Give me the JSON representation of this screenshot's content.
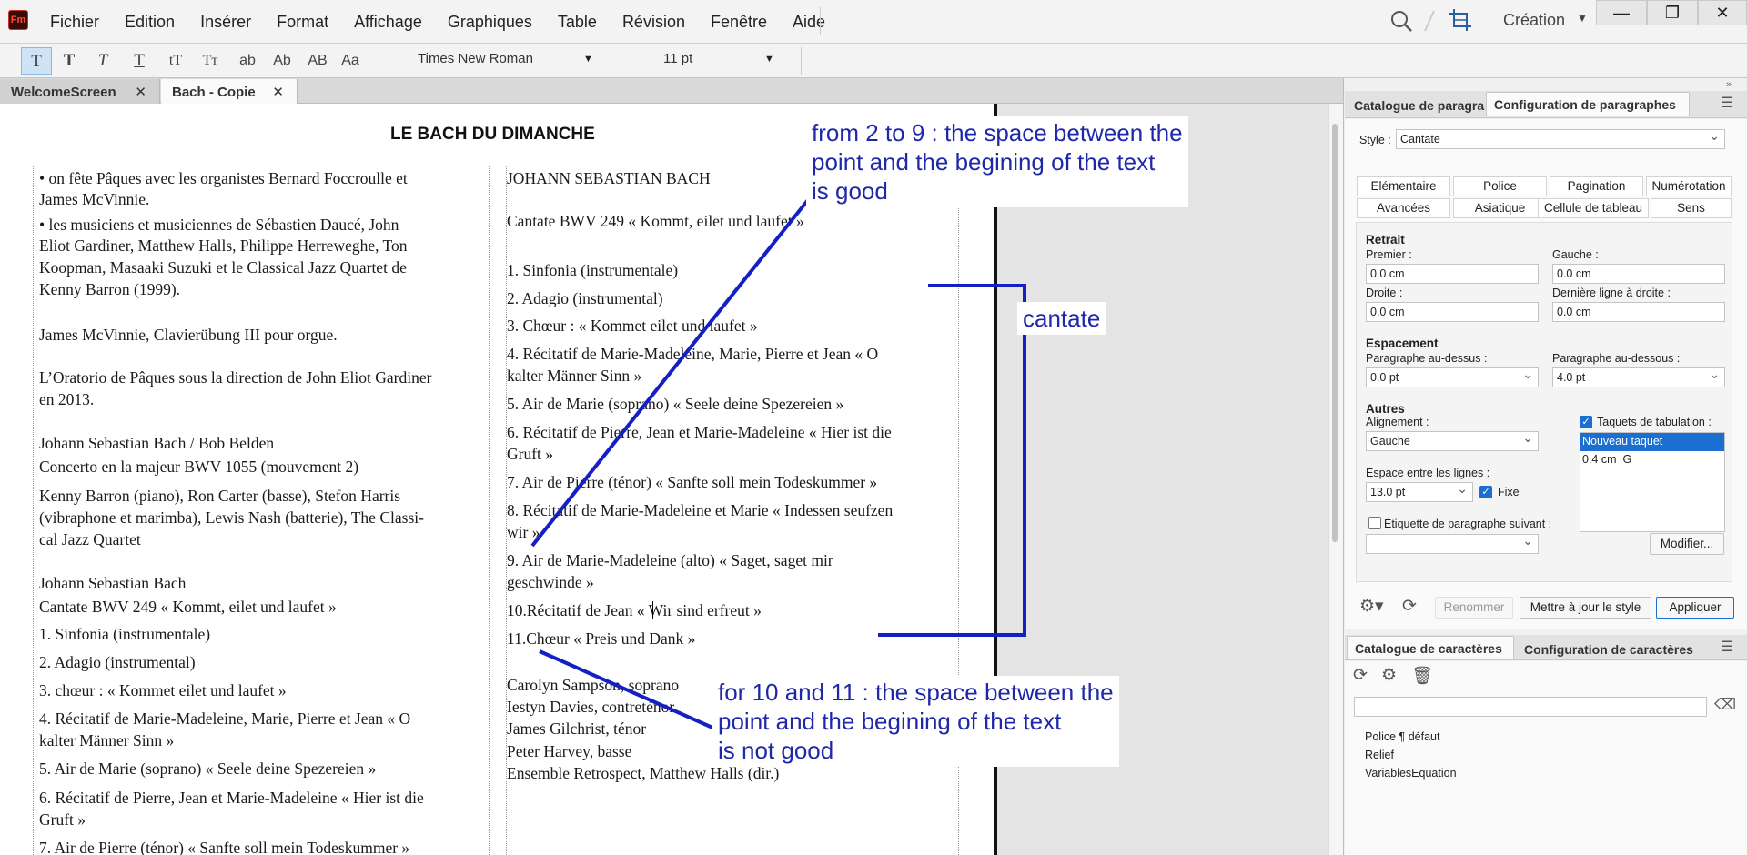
{
  "app": {
    "logo": "Fm"
  },
  "menu": [
    "Fichier",
    "Edition",
    "Insérer",
    "Format",
    "Affichage",
    "Graphiques",
    "Table",
    "Révision",
    "Fenêtre",
    "Aide"
  ],
  "workspace": "Création",
  "window_buttons": [
    "—",
    "❐",
    "✕"
  ],
  "format_toolbar": {
    "style_buttons": [
      "T",
      "T",
      "T",
      "T",
      "tT",
      "Tт",
      "ab",
      "Ab",
      "AB",
      "Aa"
    ],
    "font": "Times New Roman",
    "size": "11 pt"
  },
  "tabs": [
    {
      "label": "WelcomeScreen",
      "close": "✕"
    },
    {
      "label": "Bach - Copie",
      "close": "✕"
    }
  ],
  "document": {
    "title": "LE BACH DU DIMANCHE",
    "left_column": [
      "•  on fête Pâques avec les organistes Bernard Foccroulle et",
      "James McVinnie.",
      "•  les musiciens et musiciennes de Sébastien Daucé, John",
      "Eliot Gardiner, Matthew Halls, Philippe Herreweghe, Ton",
      "Koopman, Masaaki Suzuki et le Classical Jazz Quartet de",
      "Kenny Barron (1999).",
      "James McVinnie, Clavierübung III pour orgue.",
      "L’Oratorio de Pâques sous la direction de John Eliot Gardiner",
      "en 2013.",
      "Johann Sebastian Bach / Bob Belden",
      "Concerto en la majeur BWV 1055 (mouvement 2)",
      "Kenny Barron (piano), Ron Carter (basse), Stefon Harris",
      "(vibraphone et marimba), Lewis Nash (batterie), The Classi-",
      "cal Jazz Quartet",
      "Johann Sebastian Bach",
      "Cantate BWV 249 « Kommt, eilet und laufet »",
      "1. Sinfonia (instrumentale)",
      "2. Adagio (instrumental)",
      "3. chœur : « Kommet eilet und laufet »",
      "4. Récitatif de Marie-Madeleine, Marie, Pierre et Jean « O",
      "kalter Männer Sinn »",
      "5. Air de Marie (soprano) « Seele deine Spezereien »",
      "6. Récitatif de Pierre, Jean et Marie-Madeleine « Hier ist die",
      "Gruft »",
      "7. Air de Pierre (ténor) « Sanfte soll mein Todeskummer »"
    ],
    "right_column": [
      "JOHANN SEBASTIAN BACH",
      "Cantate BWV 249 « Kommt, eilet und laufet »",
      "1. Sinfonia (instrumentale)",
      "2. Adagio (instrumental)",
      "3. Chœur : « Kommet eilet und laufet »",
      "4. Récitatif de Marie-Madeleine, Marie, Pierre et Jean « O",
      "kalter Männer Sinn »",
      "5. Air de Marie (soprano) « Seele deine Spezereien »",
      "6. Récitatif de Pierre, Jean et Marie-Madeleine « Hier ist die",
      "Gruft »",
      "7. Air de Pierre (ténor) « Sanfte soll mein Todeskummer »",
      "8. Récitatif de Marie-Madeleine et Marie « Indessen seufzen",
      "wir »",
      "9. Air de Marie-Madeleine (alto) « Saget, saget mir",
      "geschwinde »",
      "10.Récitatif de Jean « Wir sind erfreut »",
      "11.Chœur « Preis und Dank »",
      "Carolyn Sampson, soprano",
      "Iestyn Davies, contreténor",
      "James Gilchrist, ténor",
      "Peter Harvey, basse",
      "Ensemble Retrospect, Matthew Halls (dir.)"
    ]
  },
  "annotations": {
    "good": "from 2 to 9 : the space between the\npoint and the begining of the text\nis good",
    "cantate": "cantate",
    "bad": "for 10 and 11 : the space between the\npoint and the begining of the text\nis not good",
    "color": "#1e28a8"
  },
  "para_panel": {
    "tabs": [
      "Catalogue de paragraphes",
      "Configuration de paragraphes"
    ],
    "style_label": "Style :",
    "style_value": "Cantate",
    "subtabs_row1": [
      "Elémentaire",
      "Police",
      "Pagination",
      "Numérotation"
    ],
    "subtabs_row2": [
      "Avancées",
      "Asiatique",
      "Cellule de tableau",
      "Sens"
    ],
    "retrait": {
      "title": "Retrait",
      "premier_label": "Premier :",
      "premier": "0.0 cm",
      "gauche_label": "Gauche :",
      "gauche": "0.0 cm",
      "droite_label": "Droite :",
      "droite": "0.0 cm",
      "derniere_label": "Dernière ligne à droite :",
      "derniere": "0.0 cm"
    },
    "espacement": {
      "title": "Espacement",
      "dessus_label": "Paragraphe au-dessus :",
      "dessus": "0.0 pt",
      "dessous_label": "Paragraphe au-dessous :",
      "dessous": "4.0 pt"
    },
    "autres": {
      "title": "Autres",
      "align_label": "Alignement :",
      "align": "Gauche",
      "taquets_label": "Taquets de tabulation :",
      "taquets": [
        "Nouveau taquet",
        "0.4 cm  G"
      ],
      "interligne_label": "Espace entre les lignes :",
      "interligne": "13.0 pt",
      "fixe_label": "Fixe",
      "etiquette_label": "Étiquette de paragraphe suivant :",
      "etiquette": "",
      "modifier": "Modifier..."
    },
    "buttons": {
      "renommer": "Renommer",
      "mettre": "Mettre à jour le style",
      "appliquer": "Appliquer"
    }
  },
  "char_panel": {
    "tabs": [
      "Catalogue de caractères",
      "Configuration de caractères"
    ],
    "search": "",
    "items": [
      "Police ¶ défaut",
      "Relief",
      "VariablesEquation"
    ]
  }
}
